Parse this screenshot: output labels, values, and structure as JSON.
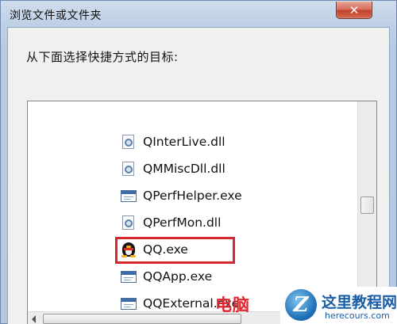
{
  "dialog": {
    "title": "浏览文件或文件夹",
    "close_label": "✕",
    "prompt": "从下面选择快捷方式的目标:"
  },
  "file_list": [
    {
      "name": "QInterLive.dll",
      "icon": "dll-icon",
      "selected": false
    },
    {
      "name": "QMMiscDll.dll",
      "icon": "dll-icon",
      "selected": false
    },
    {
      "name": "QPerfHelper.exe",
      "icon": "exe-icon",
      "selected": false
    },
    {
      "name": "QPerfMon.dll",
      "icon": "dll-icon",
      "selected": false
    },
    {
      "name": "QQ.exe",
      "icon": "qq-penguin-icon",
      "selected": true
    },
    {
      "name": "QQApp.exe",
      "icon": "exe-icon",
      "selected": false
    },
    {
      "name": "QQExternal.exe",
      "icon": "exe-icon",
      "selected": false
    }
  ],
  "highlight_color": "#d9262c",
  "watermark": {
    "left_text": "电脑",
    "logo_letter": "Z",
    "title": "这里教程网",
    "url": "herecours.com"
  }
}
